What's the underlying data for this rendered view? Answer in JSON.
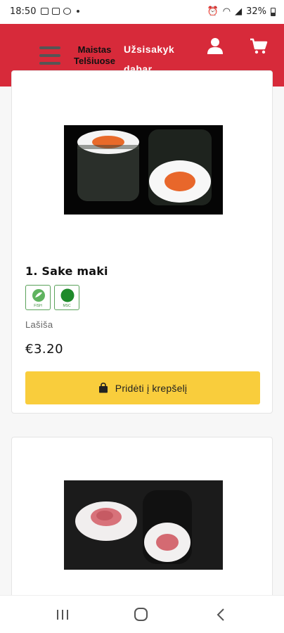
{
  "status_bar": {
    "time": "18:50",
    "battery": "32%"
  },
  "header": {
    "brand_line1": "Maistas",
    "brand_line2": "Telšiuose",
    "order_line1": "Užsisakyk",
    "order_line2": "dabar",
    "background_color": "#d72a3a",
    "menu_icon": "hamburger-menu-icon",
    "user_icon": "user-icon",
    "cart_icon": "cart-icon"
  },
  "products": [
    {
      "name": "1. Sake maki",
      "badges": [
        {
          "icon": "fish-icon",
          "label": "FISH"
        },
        {
          "icon": "msc-icon",
          "label": "MSC"
        }
      ],
      "ingredients": "Lašiša",
      "price": "€3.20",
      "add_button": "Pridėti į krepšelį"
    },
    {
      "name": "",
      "image_alt": "tuna maki"
    }
  ],
  "accent_color": "#f9cd3c",
  "nav_bar": {
    "icons": [
      "recent-apps-icon",
      "home-icon",
      "back-icon"
    ]
  }
}
